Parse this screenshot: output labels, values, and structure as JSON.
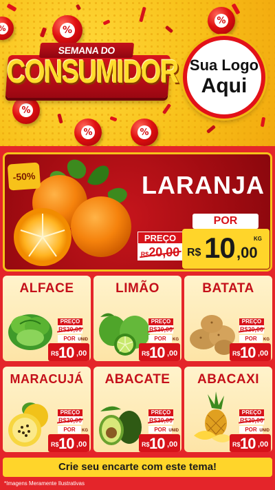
{
  "header": {
    "title_top": "SEMANA DO",
    "title_main": "CONSUMIDOR",
    "logo_line1": "Sua Logo",
    "logo_line2": "Aqui",
    "ball_symbol": "%"
  },
  "hero": {
    "discount": "-50%",
    "name": "LARANJA",
    "preco_label": "PREÇO",
    "old_currency": "R$",
    "old_price": "20,00",
    "por_label": "POR",
    "currency": "R$",
    "price_int": "10",
    "price_dec": ",00",
    "unit": "KG"
  },
  "products": [
    {
      "name": "ALFACE",
      "preco_label": "PREÇO",
      "old_price": "R$20,00",
      "por_label": "POR",
      "currency": "R$",
      "price_int": "10",
      "price_dec": ",00",
      "unit": "UNID"
    },
    {
      "name": "LIMÃO",
      "preco_label": "PREÇO",
      "old_price": "R$20,00",
      "por_label": "POR",
      "currency": "R$",
      "price_int": "10",
      "price_dec": ",00",
      "unit": "KG"
    },
    {
      "name": "BATATA",
      "preco_label": "PREÇO",
      "old_price": "R$20,00",
      "por_label": "POR",
      "currency": "R$",
      "price_int": "10",
      "price_dec": ",00",
      "unit": "KG"
    },
    {
      "name": "MARACUJÁ",
      "preco_label": "PREÇO",
      "old_price": "R$20,00",
      "por_label": "POR",
      "currency": "R$",
      "price_int": "10",
      "price_dec": ",00",
      "unit": "KG"
    },
    {
      "name": "ABACATE",
      "preco_label": "PREÇO",
      "old_price": "R$20,00",
      "por_label": "POR",
      "currency": "R$",
      "price_int": "10",
      "price_dec": ",00",
      "unit": "UNID"
    },
    {
      "name": "ABACAXI",
      "preco_label": "PREÇO",
      "old_price": "R$20,00",
      "por_label": "POR",
      "currency": "R$",
      "price_int": "10",
      "price_dec": ",00",
      "unit": "UNID"
    }
  ],
  "footer": {
    "cta": "Crie seu encarte com este tema!",
    "disclaimer": "*Imagens Meramente Ilustrativas"
  },
  "colors": {
    "brand_red": "#d7131a",
    "brand_yellow": "#ffd52a",
    "background_yellow": "#f6c21a"
  }
}
